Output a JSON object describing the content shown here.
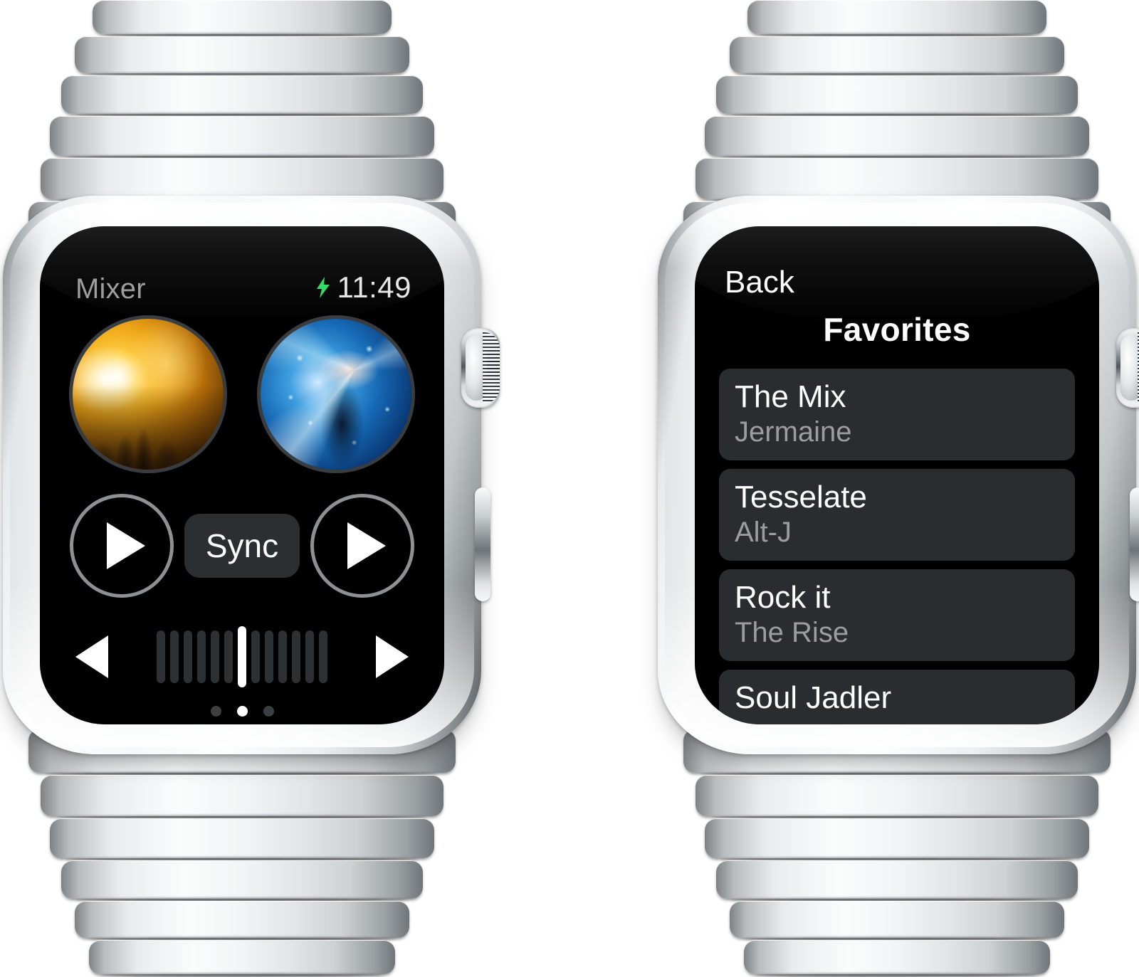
{
  "watches": {
    "left": {
      "device_name": "apple-watch-stainless-link-bracelet",
      "screen": {
        "app_name": "Mixer",
        "battery_icon": "lightning-bolt-charging-icon",
        "battery_icon_color": "#2fd862",
        "time": "11:49",
        "decks": [
          {
            "label": "deck-a",
            "art": "concert-crowd-gold-artwork",
            "play_label": "play-deck-a"
          },
          {
            "label": "deck-b",
            "art": "dancer-blue-artwork",
            "play_label": "play-deck-b"
          }
        ],
        "sync_label": "Sync",
        "crossfader": {
          "bars_total": 13,
          "active_index": 6,
          "left_arrow_icon": "triangle-left-icon",
          "right_arrow_icon": "triangle-right-icon"
        },
        "page_dots": {
          "total": 3,
          "active_index": 1
        }
      }
    },
    "right": {
      "device_name": "apple-watch-stainless-link-bracelet",
      "screen": {
        "back_label": "Back",
        "title": "Favorites",
        "items": [
          {
            "track": "The Mix",
            "artist": "Jermaine"
          },
          {
            "track": "Tesselate",
            "artist": "Alt-J"
          },
          {
            "track": "Rock it",
            "artist": "The Rise"
          },
          {
            "track": "Soul Jadler",
            "artist": ""
          }
        ]
      }
    }
  },
  "colors": {
    "screen_background": "#000000",
    "card_background": "#2a2d2f",
    "primary_text": "#ffffff",
    "secondary_text": "#9b9d9f",
    "app_name_text": "#9a9a9a",
    "charging_green": "#2fd862",
    "ring_stroke": "#8e9194",
    "fader_inactive": "#2e3133",
    "fader_active": "#ffffff",
    "case_silver": "#eceff1"
  }
}
